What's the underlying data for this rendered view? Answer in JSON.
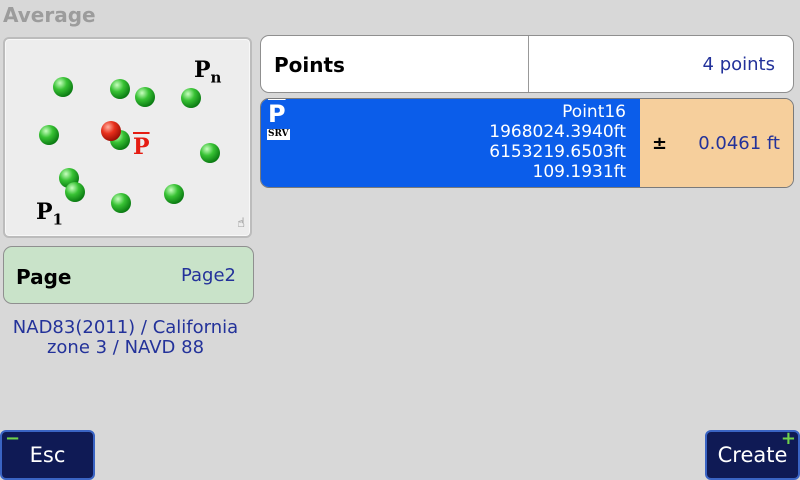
{
  "title": "Average",
  "diagram": {
    "label_n": "P",
    "label_n_sub": "n",
    "label_1": "P",
    "label_1_sub": "1",
    "avg_label": "P",
    "accent_point": "#e8301c",
    "point_color": "#38c234"
  },
  "page": {
    "label": "Page",
    "value": "Page2"
  },
  "crs": {
    "line1": "NAD83(2011) / California",
    "line2": "zone 3 / NAVD 88"
  },
  "points": {
    "label": "Points",
    "value": "4 points"
  },
  "average": {
    "symbol": "P",
    "badge": "SRV",
    "point_name": "Point16",
    "northing": "1968024.3940ft",
    "easting": "6153219.6503ft",
    "elevation": "109.1931ft",
    "pm_symbol": "±",
    "tolerance": "0.0461 ft",
    "colors": {
      "left": "#0b5dea",
      "right": "#f6cf9c"
    }
  },
  "buttons": {
    "esc": "Esc",
    "esc_icon": "minus-icon",
    "create": "Create",
    "create_icon": "plus-icon"
  }
}
